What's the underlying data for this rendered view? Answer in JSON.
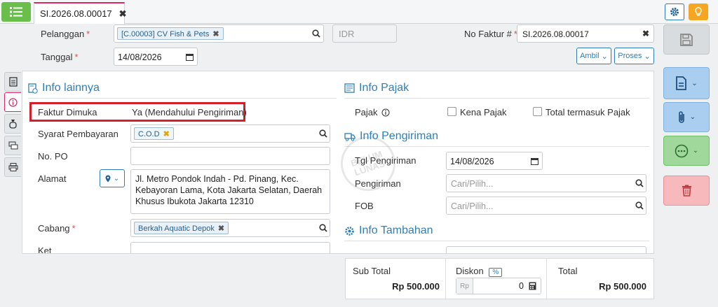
{
  "tab": {
    "doc_number": "SI.2026.08.00017"
  },
  "header": {
    "customer_label": "Pelanggan",
    "customer_tag": "[C.00003] CV Fish & Pets",
    "currency": "IDR",
    "invoice_label": "No Faktur #",
    "invoice_value": "SI.2026.08.00017",
    "date_label": "Tanggal",
    "date_value": "14/08/2026",
    "ambil_label": "Ambil",
    "proses_label": "Proses"
  },
  "info_lainnya": {
    "title": "Info lainnya",
    "faktur_dimuka_label": "Faktur Dimuka",
    "faktur_dimuka_value": "Ya (Mendahului Pengiriman)",
    "syarat_label": "Syarat Pembayaran",
    "syarat_tag": "C.O.D",
    "po_label": "No. PO",
    "po_value": "",
    "alamat_label": "Alamat",
    "alamat_value": "Jl. Metro Pondok Indah - Pd. Pinang, Kec. Kebayoran Lama, Kota Jakarta Selatan, Daerah Khusus Ibukota Jakarta 12310",
    "cabang_label": "Cabang",
    "cabang_tag": "Berkah Aquatic Depok",
    "next_label": "Ket"
  },
  "info_pajak": {
    "title": "Info Pajak",
    "pajak_label": "Pajak",
    "kena_pajak": "Kena Pajak",
    "total_pajak": "Total termasuk Pajak"
  },
  "info_pengiriman": {
    "title": "Info Pengiriman",
    "tgl_label": "Tgl Pengiriman",
    "tgl_value": "14/08/2026",
    "pengiriman_label": "Pengiriman",
    "pengiriman_placeholder": "Cari/Pilih...",
    "fob_label": "FOB",
    "fob_placeholder": "Cari/Pilih..."
  },
  "info_tambahan": {
    "title": "Info Tambahan"
  },
  "watermark": "BELUM LUNAS",
  "totals": {
    "subtotal_label": "Sub Total",
    "subtotal_value": "Rp 500.000",
    "diskon_label": "Diskon",
    "diskon_badge": "%",
    "diskon_prefix": "Rp",
    "diskon_value": "0",
    "total_label": "Total",
    "total_value": "Rp 500.000"
  },
  "colors": {
    "accent_blue": "#2e7fb8",
    "menu_green": "#6abf4b",
    "highlight_red": "#d4202a",
    "required_red": "#d9534f"
  }
}
